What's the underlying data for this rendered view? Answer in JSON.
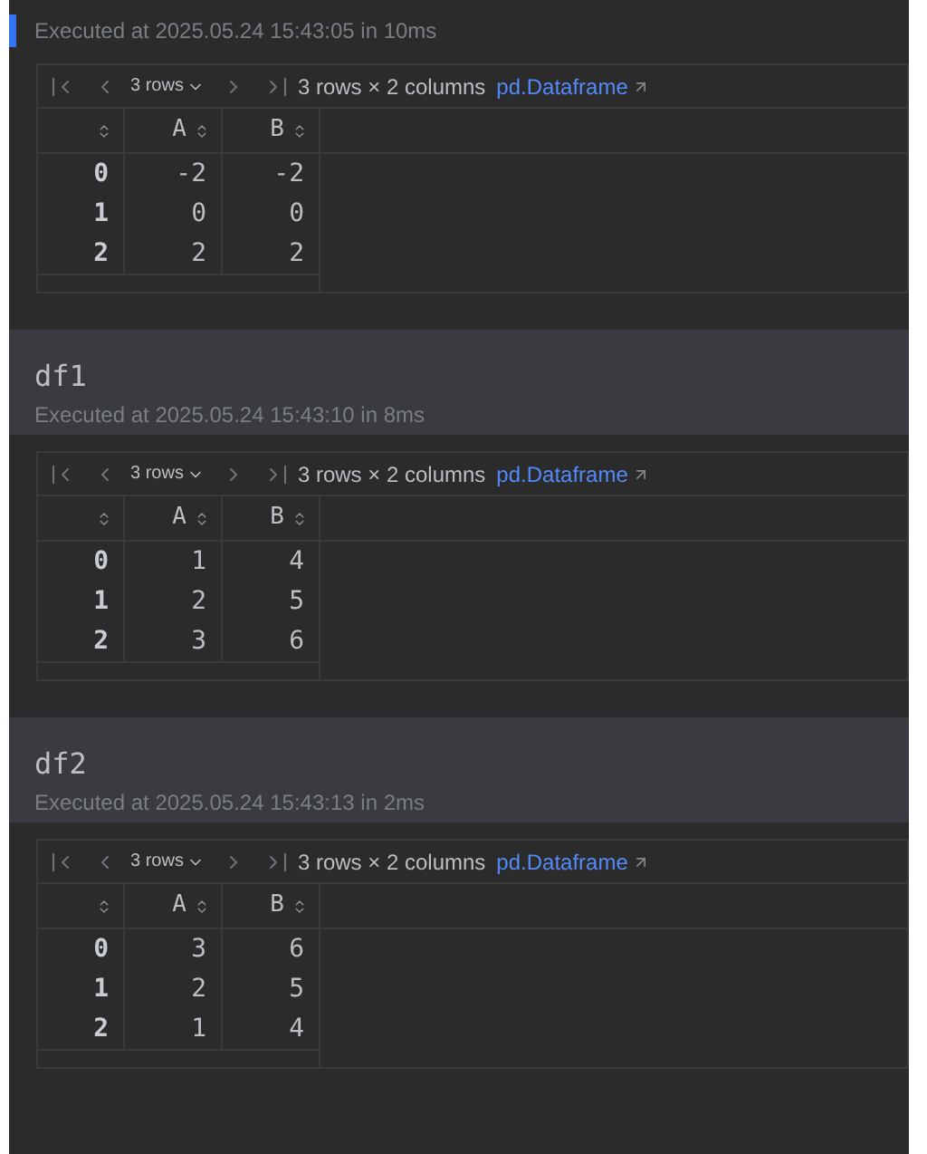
{
  "sections": [
    {
      "executed": "Executed at 2025.05.24 15:43:05 in 10ms",
      "active": true,
      "table": {
        "page_size": "3 rows",
        "summary": "3 rows × 2 columns",
        "link": "pd.Dataframe",
        "columns": [
          "",
          "A",
          "B"
        ],
        "rows": [
          [
            "0",
            "-2",
            "-2"
          ],
          [
            "1",
            "0",
            "0"
          ],
          [
            "2",
            "2",
            "2"
          ]
        ]
      }
    },
    {
      "title": "df1",
      "executed": "Executed at 2025.05.24 15:43:10 in 8ms",
      "active": false,
      "table": {
        "page_size": "3 rows",
        "summary": "3 rows × 2 columns",
        "link": "pd.Dataframe",
        "columns": [
          "",
          "A",
          "B"
        ],
        "rows": [
          [
            "0",
            "1",
            "4"
          ],
          [
            "1",
            "2",
            "5"
          ],
          [
            "2",
            "3",
            "6"
          ]
        ]
      }
    },
    {
      "title": "df2",
      "executed": "Executed at 2025.05.24 15:43:13 in 2ms",
      "active": false,
      "table": {
        "page_size": "3 rows",
        "summary": "3 rows × 2 columns",
        "link": "pd.Dataframe",
        "columns": [
          "",
          "A",
          "B"
        ],
        "rows": [
          [
            "0",
            "3",
            "6"
          ],
          [
            "1",
            "2",
            "5"
          ],
          [
            "2",
            "1",
            "4"
          ]
        ]
      }
    }
  ]
}
